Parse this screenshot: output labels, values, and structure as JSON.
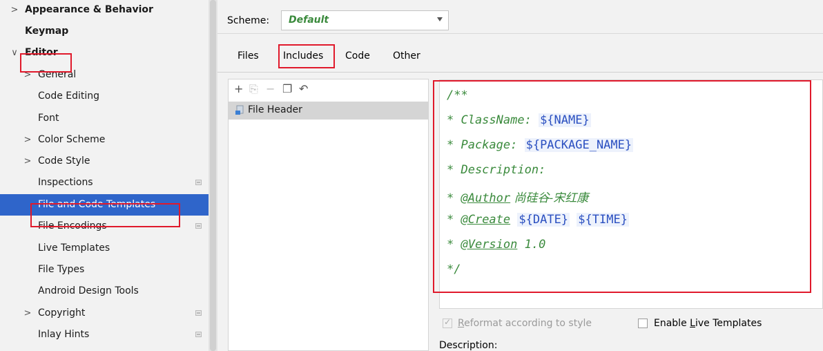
{
  "sidebar": {
    "items": [
      {
        "label": "Appearance & Behavior",
        "chevron": ">",
        "bold": true
      },
      {
        "label": "Keymap",
        "bold": true
      },
      {
        "label": "Editor",
        "chevron": "∨",
        "bold": true
      },
      {
        "label": "General",
        "chevron": ">"
      },
      {
        "label": "Code Editing"
      },
      {
        "label": "Font"
      },
      {
        "label": "Color Scheme",
        "chevron": ">"
      },
      {
        "label": "Code Style",
        "chevron": ">"
      },
      {
        "label": "Inspections",
        "project_icon": true
      },
      {
        "label": "File and Code Templates",
        "selected": true
      },
      {
        "label": "File Encodings",
        "project_icon": true
      },
      {
        "label": "Live Templates"
      },
      {
        "label": "File Types"
      },
      {
        "label": "Android Design Tools"
      },
      {
        "label": "Copyright",
        "chevron": ">",
        "project_icon": true
      },
      {
        "label": "Inlay Hints",
        "project_icon": true
      }
    ]
  },
  "scheme": {
    "label": "Scheme:",
    "value": "Default"
  },
  "tabs": [
    {
      "label": "Files"
    },
    {
      "label": "Includes",
      "active": true
    },
    {
      "label": "Code"
    },
    {
      "label": "Other"
    }
  ],
  "templates": {
    "toolbar_icons": [
      "plus-icon",
      "copy-template-icon",
      "minus-icon",
      "duplicate-icon",
      "reset-icon"
    ],
    "items": [
      {
        "label": "File Header"
      }
    ]
  },
  "editor": {
    "lines": [
      [
        {
          "t": "/**",
          "s": "cm"
        }
      ],
      [
        {
          "t": "* ClassName: ",
          "s": "cm"
        },
        {
          "t": "${NAME}",
          "s": "var"
        }
      ],
      [
        {
          "t": "* Package: ",
          "s": "cm"
        },
        {
          "t": "${PACKAGE_NAME}",
          "s": "var"
        }
      ],
      [
        {
          "t": "* Description:",
          "s": "cm"
        }
      ],
      [
        {
          "t": "* ",
          "s": "cm"
        },
        {
          "t": "@Author",
          "s": "tag"
        },
        {
          "t": " 尚硅谷-宋红康",
          "s": "val cn"
        }
      ],
      [
        {
          "t": "* ",
          "s": "cm"
        },
        {
          "t": "@Create",
          "s": "tag"
        },
        {
          "t": " ",
          "s": "cm"
        },
        {
          "t": "${DATE}",
          "s": "var"
        },
        {
          "t": " ",
          "s": "cm"
        },
        {
          "t": "${TIME}",
          "s": "var"
        }
      ],
      [
        {
          "t": "* ",
          "s": "cm"
        },
        {
          "t": "@Version",
          "s": "tag"
        },
        {
          "t": " 1.0",
          "s": "val"
        }
      ],
      [
        {
          "t": "*/",
          "s": "cm"
        }
      ]
    ]
  },
  "options": {
    "reformat": {
      "label_first": "R",
      "label_rest": "eformat according to style",
      "checked": true,
      "disabled": true
    },
    "live_templates": {
      "label_pre": "Enable ",
      "label_u": "L",
      "label_rest": "ive Templates",
      "checked": false
    }
  },
  "description_label": "Description:",
  "colors": {
    "selection": "#2f65ca",
    "highlight_box": "#e0192b",
    "comment": "#3a8a3c",
    "variable": "#2a4fc0"
  }
}
